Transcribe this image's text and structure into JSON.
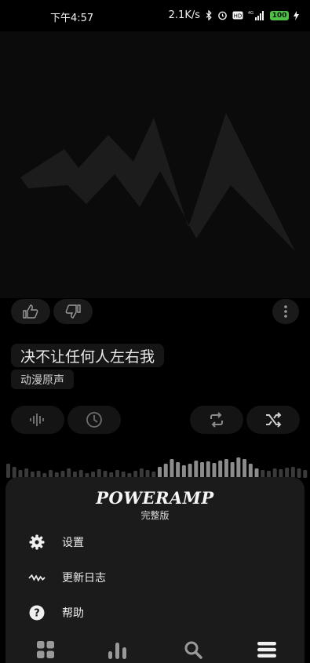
{
  "status_bar": {
    "time": "下午4:57",
    "network_speed": "2.1K/s",
    "battery": "100",
    "icons": [
      "bluetooth-icon",
      "alarm-icon",
      "hd-icon",
      "signal-icon",
      "battery-icon",
      "charging-icon"
    ]
  },
  "player": {
    "track_title": "决不让任何人左右我",
    "album": "动漫原声",
    "buttons": [
      "thumbs-up-icon",
      "thumbs-down-icon",
      "more-vert-icon",
      "waves-icon",
      "clock-icon",
      "repeat-icon",
      "shuffle-icon"
    ]
  },
  "menu": {
    "logo": "POWERAMP",
    "edition": "完整版",
    "items": [
      {
        "label": "设置",
        "icon": "gear-icon"
      },
      {
        "label": "更新日志",
        "icon": "changelog-wave-icon"
      },
      {
        "label": "帮助",
        "icon": "help-icon"
      }
    ]
  },
  "bottom_nav": [
    "library-grid-icon",
    "equalizer-icon",
    "search-icon",
    "menu-icon"
  ],
  "colors": {
    "background": "#000000",
    "sheet": "#1b1b1b",
    "battery": "#4fbf48"
  }
}
